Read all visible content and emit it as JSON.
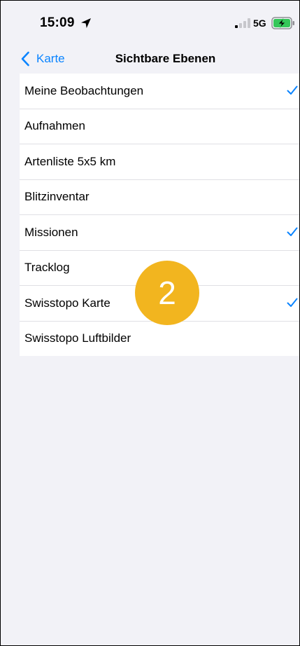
{
  "status_bar": {
    "time": "15:09",
    "location_icon": "location-arrow-icon",
    "signal_icon": "cellular-signal-icon",
    "network": "5G",
    "battery_icon": "battery-charging-icon"
  },
  "nav": {
    "back_label": "Karte",
    "back_icon": "chevron-left-icon",
    "title": "Sichtbare Ebenen"
  },
  "layers": [
    {
      "label": "Meine Beobachtungen",
      "checked": true
    },
    {
      "label": "Aufnahmen",
      "checked": false
    },
    {
      "label": "Artenliste 5x5 km",
      "checked": false
    },
    {
      "label": "Blitzinventar",
      "checked": false
    },
    {
      "label": "Missionen",
      "checked": true
    },
    {
      "label": "Tracklog",
      "checked": false
    },
    {
      "label": "Swisstopo Karte",
      "checked": true
    },
    {
      "label": "Swisstopo Luftbilder",
      "checked": false
    }
  ],
  "step_badge": {
    "number": "2",
    "color": "#f2b51f"
  },
  "colors": {
    "accent": "#0a84ff",
    "background": "#f2f2f7",
    "list_background": "#ffffff",
    "separator": "#e0e0e4"
  }
}
